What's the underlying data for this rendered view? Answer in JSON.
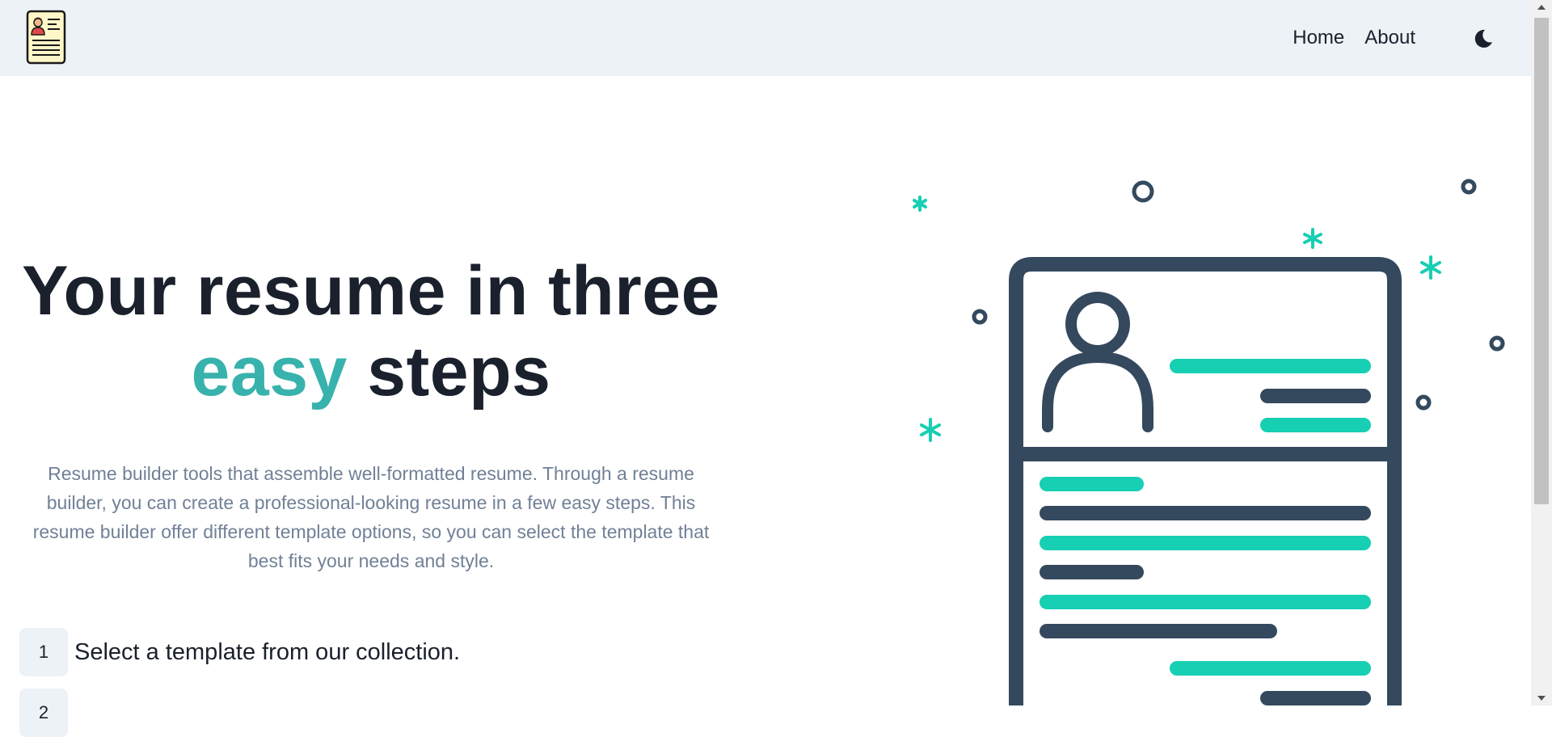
{
  "nav": {
    "logo_icon": "resume-document-icon",
    "links": [
      {
        "label": "Home"
      },
      {
        "label": "About"
      }
    ],
    "theme_icon": "moon-icon"
  },
  "hero": {
    "title_line1": "Your resume in three",
    "title_accent": "easy",
    "title_rest": " steps",
    "description": "Resume builder tools that assemble well-formatted resume. Through a resume builder, you can create a professional-looking resume in a few easy steps. This resume builder offer different template options, so you can select the template that best fits your needs and style.",
    "steps": [
      {
        "number": "1",
        "text": "Select a template from our collection."
      },
      {
        "number": "2",
        "text": ""
      }
    ]
  },
  "illustration": {
    "icon": "resume-illustration-icon"
  },
  "colors": {
    "accent": "#38b2ac",
    "illustration_teal": "#17cfb2",
    "illustration_dark": "#34495e",
    "navbar_bg": "#edf2f7"
  }
}
